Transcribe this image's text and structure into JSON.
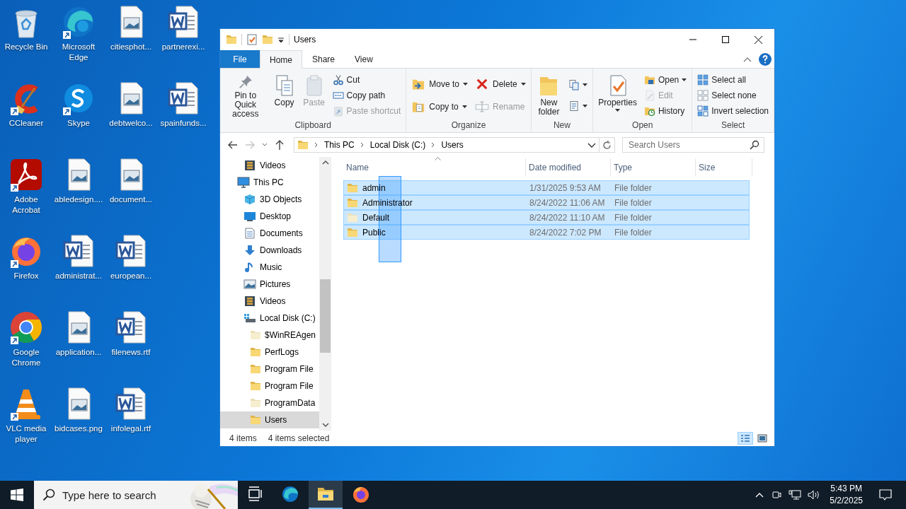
{
  "desktop": {
    "icons": [
      {
        "label": "Recycle Bin",
        "kind": "recycle",
        "shortcut": false
      },
      {
        "label": "CCleaner",
        "kind": "ccleaner",
        "shortcut": true
      },
      {
        "label": "Adobe Acrobat",
        "kind": "acrobat",
        "shortcut": true
      },
      {
        "label": "Firefox",
        "kind": "firefox",
        "shortcut": true
      },
      {
        "label": "Google Chrome",
        "kind": "chrome",
        "shortcut": true
      },
      {
        "label": "VLC media player",
        "kind": "vlc",
        "shortcut": true
      },
      {
        "label": "Microsoft Edge",
        "kind": "edge",
        "shortcut": true
      },
      {
        "label": "Skype",
        "kind": "skype",
        "shortcut": true
      },
      {
        "label": "abledesign....",
        "kind": "image",
        "shortcut": false
      },
      {
        "label": "administrat...",
        "kind": "word",
        "shortcut": false
      },
      {
        "label": "application...",
        "kind": "image",
        "shortcut": false
      },
      {
        "label": "bidcases.png",
        "kind": "image",
        "shortcut": false
      },
      {
        "label": "citiesphot...",
        "kind": "image",
        "shortcut": false
      },
      {
        "label": "debtwelco...",
        "kind": "image",
        "shortcut": false
      },
      {
        "label": "document...",
        "kind": "image",
        "shortcut": false
      },
      {
        "label": "european...",
        "kind": "word",
        "shortcut": false
      },
      {
        "label": "filenews.rtf",
        "kind": "word",
        "shortcut": false
      },
      {
        "label": "infolegal.rtf",
        "kind": "word",
        "shortcut": false
      },
      {
        "label": "partnerexi...",
        "kind": "word",
        "shortcut": false
      },
      {
        "label": "spainfunds...",
        "kind": "word",
        "shortcut": false
      }
    ]
  },
  "window": {
    "title": "Users",
    "tabs": [
      {
        "label": "File",
        "kind": "file",
        "selected": false
      },
      {
        "label": "Home",
        "kind": "tab",
        "selected": true
      },
      {
        "label": "Share",
        "kind": "tab",
        "selected": false
      },
      {
        "label": "View",
        "kind": "tab",
        "selected": false
      }
    ],
    "ribbon": [
      {
        "label": "Clipboard",
        "columns": [
          [
            {
              "kind": "large",
              "label": "Pin to Quick access",
              "disabled": false,
              "dropdown": false
            }
          ],
          [
            {
              "kind": "large",
              "label": "Copy",
              "disabled": false,
              "dropdown": false
            }
          ],
          [
            {
              "kind": "large",
              "label": "Paste",
              "disabled": true,
              "dropdown": false
            }
          ],
          [
            {
              "kind": "small",
              "label": "Cut",
              "disabled": false,
              "dropdown": false
            },
            {
              "kind": "small",
              "label": "Copy path",
              "disabled": false,
              "dropdown": false
            },
            {
              "kind": "small",
              "label": "Paste shortcut",
              "disabled": true,
              "dropdown": false
            }
          ]
        ]
      },
      {
        "label": "Organize",
        "columns": [
          [
            {
              "kind": "medium",
              "label": "Move to",
              "disabled": false,
              "dropdown": true
            },
            {
              "kind": "medium",
              "label": "Copy to",
              "disabled": false,
              "dropdown": true
            }
          ],
          [
            {
              "kind": "medium",
              "label": "Delete",
              "disabled": false,
              "dropdown": true
            },
            {
              "kind": "medium",
              "label": "Rename",
              "disabled": true,
              "dropdown": false
            }
          ]
        ]
      },
      {
        "label": "New",
        "columns": [
          [
            {
              "kind": "large",
              "label": "New folder",
              "disabled": false,
              "dropdown": false
            }
          ],
          [
            {
              "kind": "small",
              "disabled": false,
              "dropdown": true
            },
            {
              "kind": "small",
              "disabled": false,
              "dropdown": true
            }
          ]
        ]
      },
      {
        "label": "Open",
        "columns": [
          [
            {
              "kind": "large",
              "label": "Properties",
              "disabled": false,
              "dropdown": true
            }
          ],
          [
            {
              "kind": "small",
              "label": "Open",
              "disabled": false,
              "dropdown": true
            },
            {
              "kind": "small",
              "label": "Edit",
              "disabled": true,
              "dropdown": false
            },
            {
              "kind": "small",
              "label": "History",
              "disabled": false,
              "dropdown": false
            }
          ]
        ]
      },
      {
        "label": "Select",
        "columns": [
          [
            {
              "kind": "small",
              "label": "Select all",
              "disabled": false,
              "dropdown": false
            },
            {
              "kind": "small",
              "label": "Select none",
              "disabled": false,
              "dropdown": false
            },
            {
              "kind": "small",
              "label": "Invert selection",
              "disabled": false,
              "dropdown": false
            }
          ]
        ]
      }
    ],
    "address": {
      "path": [
        "This PC",
        "Local Disk (C:)",
        "Users"
      ]
    },
    "search": {
      "placeholder": "Search Users"
    },
    "nav_tree": [
      {
        "children": [
          {
            "label": "Videos",
            "kind": "video",
            "selected": false
          }
        ]
      },
      {
        "label": "This PC",
        "kind": "pc",
        "selected": false,
        "children": [
          {
            "label": "3D Objects",
            "kind": "cube",
            "selected": false
          },
          {
            "label": "Desktop",
            "kind": "desktop",
            "selected": false
          },
          {
            "label": "Documents",
            "kind": "documents",
            "selected": false
          },
          {
            "label": "Downloads",
            "kind": "downloads",
            "selected": false
          },
          {
            "label": "Music",
            "kind": "music",
            "selected": false
          },
          {
            "label": "Pictures",
            "kind": "pictures",
            "selected": false
          },
          {
            "label": "Videos",
            "kind": "video",
            "selected": false
          },
          {
            "label": "Local Disk (C:)",
            "kind": "drive",
            "selected": false,
            "children": [
              {
                "label": "$WinREAgen",
                "kind": "folder",
                "hidden": true,
                "selected": false
              },
              {
                "label": "PerfLogs",
                "kind": "folder",
                "hidden": false,
                "selected": false
              },
              {
                "label": "Program File",
                "kind": "folder",
                "hidden": false,
                "selected": false
              },
              {
                "label": "Program File",
                "kind": "folder",
                "hidden": false,
                "selected": false
              },
              {
                "label": "ProgramData",
                "kind": "folder",
                "hidden": true,
                "selected": false
              },
              {
                "label": "Users",
                "kind": "folder",
                "hidden": false,
                "selected": true
              }
            ]
          }
        ]
      }
    ],
    "columns": [
      {
        "label": "Name",
        "sorted": true
      },
      {
        "label": "Date modified",
        "sorted": false
      },
      {
        "label": "Type",
        "sorted": false
      },
      {
        "label": "Size",
        "sorted": false
      }
    ],
    "rows": [
      {
        "name": "admin",
        "date": "1/31/2025 9:53 AM",
        "type": "File folder",
        "hidden": false,
        "selected": true
      },
      {
        "name": "Administrator",
        "date": "8/24/2022 11:06 AM",
        "type": "File folder",
        "hidden": false,
        "selected": true
      },
      {
        "name": "Default",
        "date": "8/24/2022 11:10 AM",
        "type": "File folder",
        "hidden": true,
        "selected": true
      },
      {
        "name": "Public",
        "date": "8/24/2022 7:02 PM",
        "type": "File folder",
        "hidden": false,
        "selected": true
      }
    ],
    "status": {
      "count": "4 items",
      "selection": "4 items selected"
    },
    "views": [
      {
        "kind": "details",
        "selected": true
      },
      {
        "kind": "large-icons",
        "selected": false
      }
    ]
  },
  "taskbar": {
    "search": {
      "placeholder": "Type here to search"
    },
    "apps": [
      {
        "kind": "task-view",
        "active": false
      },
      {
        "kind": "edge",
        "active": false
      },
      {
        "kind": "explorer",
        "active": true
      },
      {
        "kind": "firefox",
        "active": false
      }
    ],
    "clock": {
      "time": "5:43 PM",
      "date": "5/2/2025"
    }
  }
}
